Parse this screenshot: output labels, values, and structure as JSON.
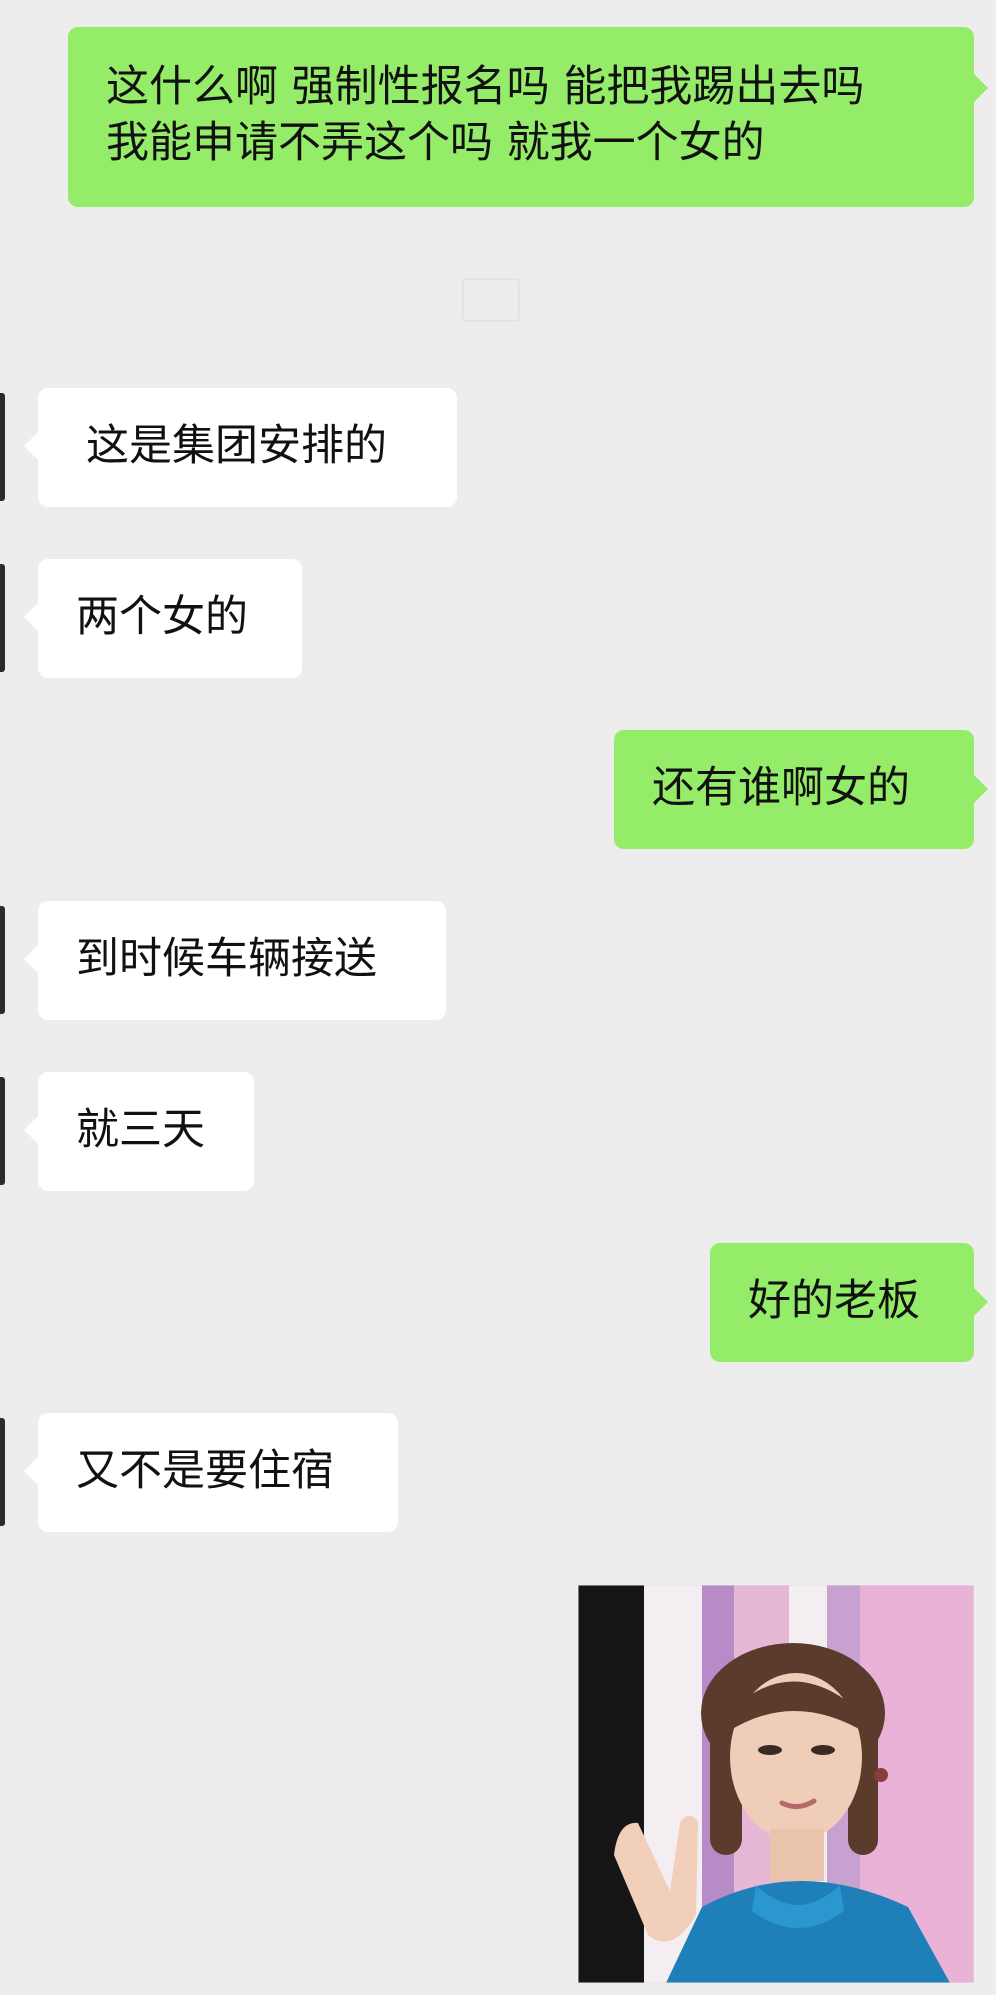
{
  "conversation": {
    "messages": [
      {
        "sender": "me",
        "lines": [
          "这什么啊 强制性报名吗 能把我踢出去吗",
          "我能申请不弄这个吗 就我一个女的"
        ]
      },
      {
        "sender": "them",
        "text": "这是集团安排的"
      },
      {
        "sender": "them",
        "text": "两个女的"
      },
      {
        "sender": "me",
        "text": "还有谁啊女的"
      },
      {
        "sender": "them",
        "text": "到时候车辆接送"
      },
      {
        "sender": "them",
        "text": "就三天"
      },
      {
        "sender": "me",
        "text": "好的老板"
      },
      {
        "sender": "them",
        "text": "又不是要住宿"
      }
    ],
    "sticker": {
      "description_icon": "meme-sticker-image"
    }
  },
  "theme": {
    "background": "#ededed",
    "bubble_me": "#95ec69",
    "bubble_them": "#ffffff",
    "text": "#111111"
  }
}
